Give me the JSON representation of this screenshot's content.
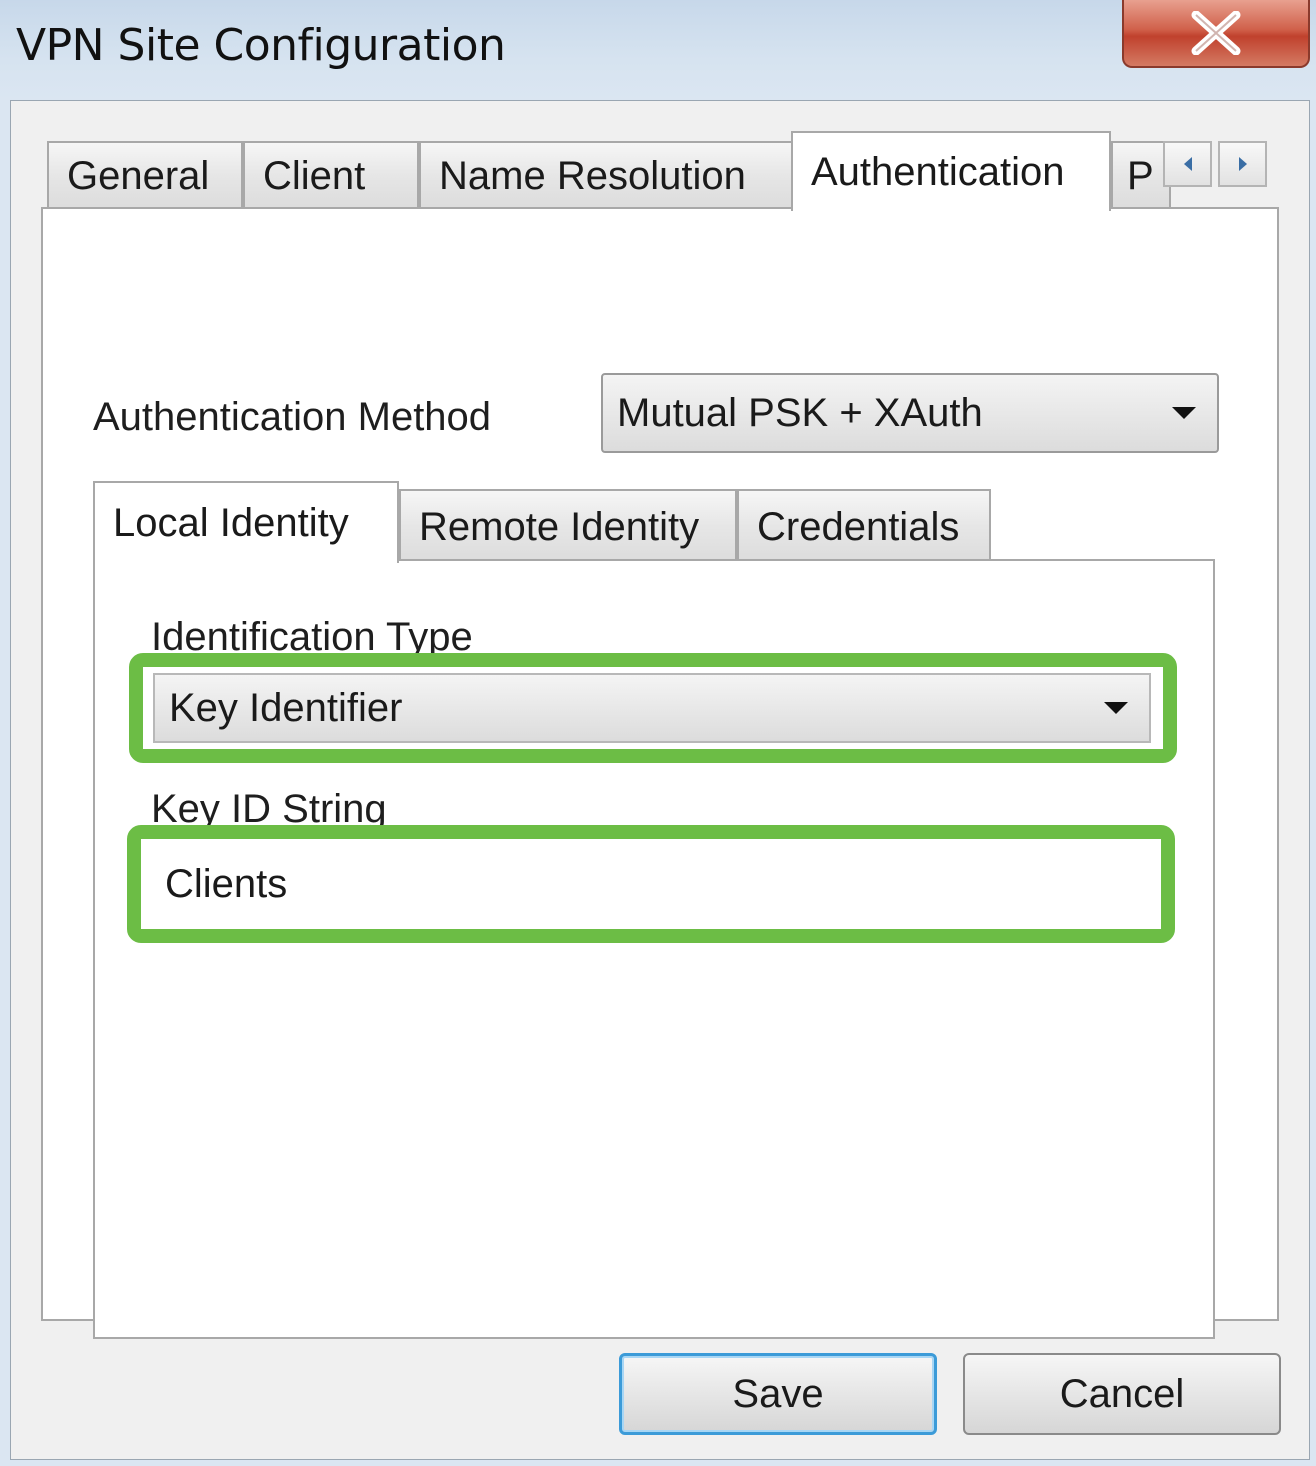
{
  "window": {
    "title": "VPN Site Configuration"
  },
  "outer_tabs": [
    {
      "label": "General",
      "active": false
    },
    {
      "label": "Client",
      "active": false
    },
    {
      "label": "Name Resolution",
      "active": false
    },
    {
      "label": "Authentication",
      "active": true
    },
    {
      "label": "P",
      "active": false
    }
  ],
  "authentication": {
    "method_label": "Authentication Method",
    "method_value": "Mutual PSK + XAuth"
  },
  "inner_tabs": [
    {
      "label": "Local Identity",
      "active": true
    },
    {
      "label": "Remote Identity",
      "active": false
    },
    {
      "label": "Credentials",
      "active": false
    }
  ],
  "local_identity": {
    "identification_type_label": "Identification Type",
    "identification_type_value": "Key Identifier",
    "key_id_label": "Key ID String",
    "key_id_value": "Clients"
  },
  "buttons": {
    "save": "Save",
    "cancel": "Cancel"
  },
  "colors": {
    "highlight": "#6cbd45",
    "close_button": "#c9503b",
    "default_button_border": "#3c9bd8"
  }
}
